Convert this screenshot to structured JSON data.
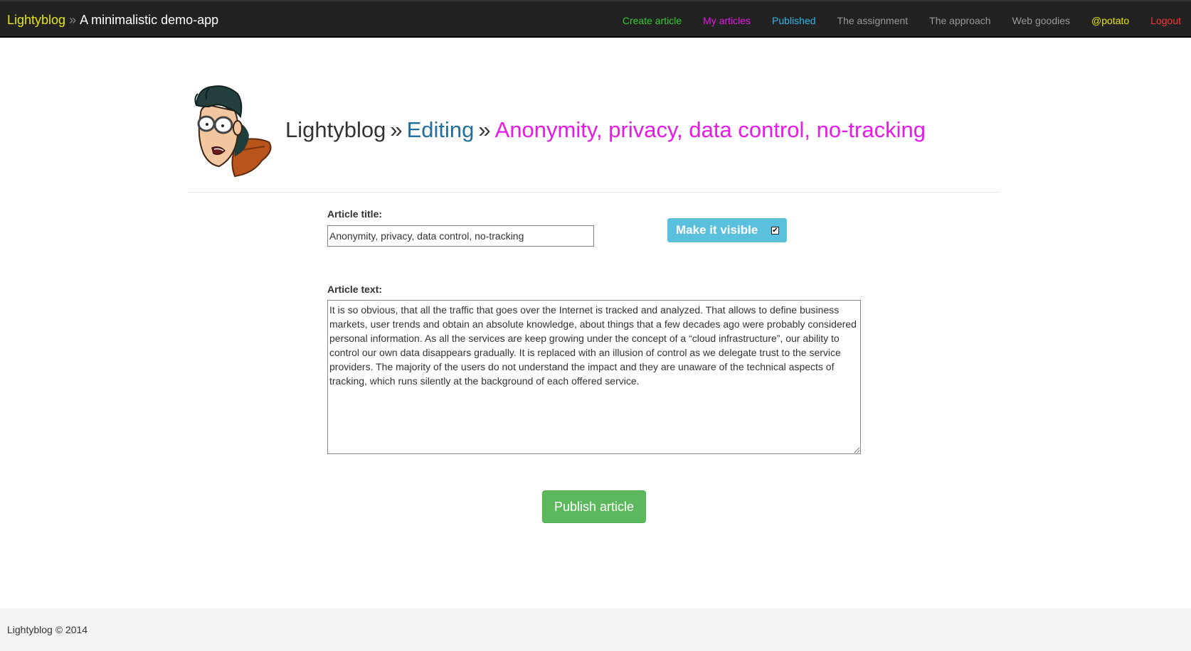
{
  "navbar": {
    "brand": "Lightyblog",
    "separator": "»",
    "tagline": "A minimalistic demo-app",
    "links": [
      {
        "label": "Create article",
        "color": "#33cc33"
      },
      {
        "label": "My articles",
        "color": "#e619e6"
      },
      {
        "label": "Published",
        "color": "#33b5e5"
      },
      {
        "label": "The assignment",
        "color": "#999999"
      },
      {
        "label": "The approach",
        "color": "#999999"
      },
      {
        "label": "Web goodies",
        "color": "#999999"
      },
      {
        "label": "@potato",
        "color": "#e6e600"
      },
      {
        "label": "Logout",
        "color": "#ff3333"
      }
    ]
  },
  "header": {
    "avatar_icon": "cartoon-avatar",
    "crumb_root": "Lightyblog",
    "separator": "»",
    "crumb_mode": "Editing",
    "crumb_article": "Anonymity, privacy, data control, no-tracking"
  },
  "form": {
    "title_label": "Article title:",
    "title_value": "Anonymity, privacy, data control, no-tracking",
    "visibility_label": "Make it visible",
    "visibility_checked": true,
    "text_label": "Article text:",
    "text_value": "It is so obvious, that all the traffic that goes over the Internet is tracked and analyzed. That allows to define business markets, user trends and obtain an absolute knowledge, about things that a few decades ago were probably considered personal information. As all the services are keep growing under the concept of a “cloud infrastructure”, our ability to control our own data disappears gradually. It is replaced with an illusion of control as we delegate trust to the service providers. The majority of the users do not understand the impact and they are unaware of the technical aspects of tracking, which runs silently at the background of each offered service.",
    "publish_label": "Publish article"
  },
  "footer": {
    "text": "Lightyblog © 2014"
  }
}
